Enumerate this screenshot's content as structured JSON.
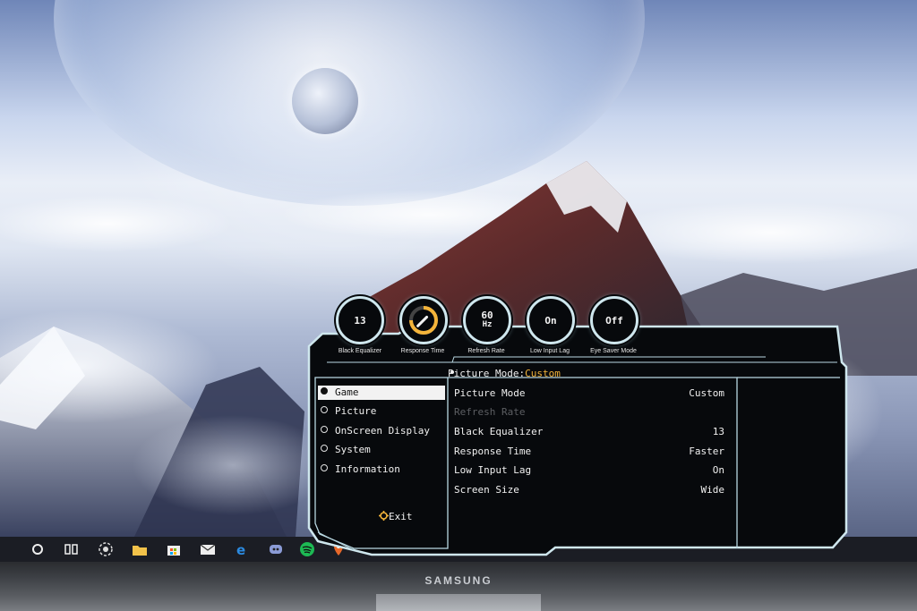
{
  "taskbar": {
    "icons": [
      "cortana-circle-icon",
      "task-view-icon",
      "app-flower-icon",
      "file-explorer-icon",
      "store-icon",
      "mail-icon",
      "edge-icon",
      "discord-icon",
      "spotify-icon",
      "maps-pin-icon"
    ]
  },
  "monitor": {
    "brand": "SAMSUNG"
  },
  "osd": {
    "status": [
      {
        "value": "13",
        "label": "Black Equalizer"
      },
      {
        "value": "",
        "label": "Response Time",
        "level": 0.75
      },
      {
        "value": "60",
        "unit": "Hz",
        "label": "Refresh Rate"
      },
      {
        "value": "On",
        "label": "Low Input Lag"
      },
      {
        "value": "Off",
        "label": "Eye Saver Mode"
      }
    ],
    "picture_mode_label": "Picture Mode:",
    "picture_mode_value": "Custom",
    "menu": [
      {
        "label": "Game",
        "selected": true
      },
      {
        "label": "Picture"
      },
      {
        "label": "OnScreen Display"
      },
      {
        "label": "System"
      },
      {
        "label": "Information"
      }
    ],
    "exit_label": "Exit",
    "settings": [
      {
        "label": "Picture Mode",
        "value": "Custom"
      },
      {
        "label": "Refresh Rate",
        "value": "",
        "disabled": true
      },
      {
        "label": "Black Equalizer",
        "value": "13"
      },
      {
        "label": "Response Time",
        "value": "Faster"
      },
      {
        "label": "Low Input Lag",
        "value": "On"
      },
      {
        "label": "Screen Size",
        "value": "Wide"
      }
    ],
    "colors": {
      "frame": "#cfe7ee",
      "accent": "#f4b43a",
      "panel": "#07090c"
    }
  }
}
